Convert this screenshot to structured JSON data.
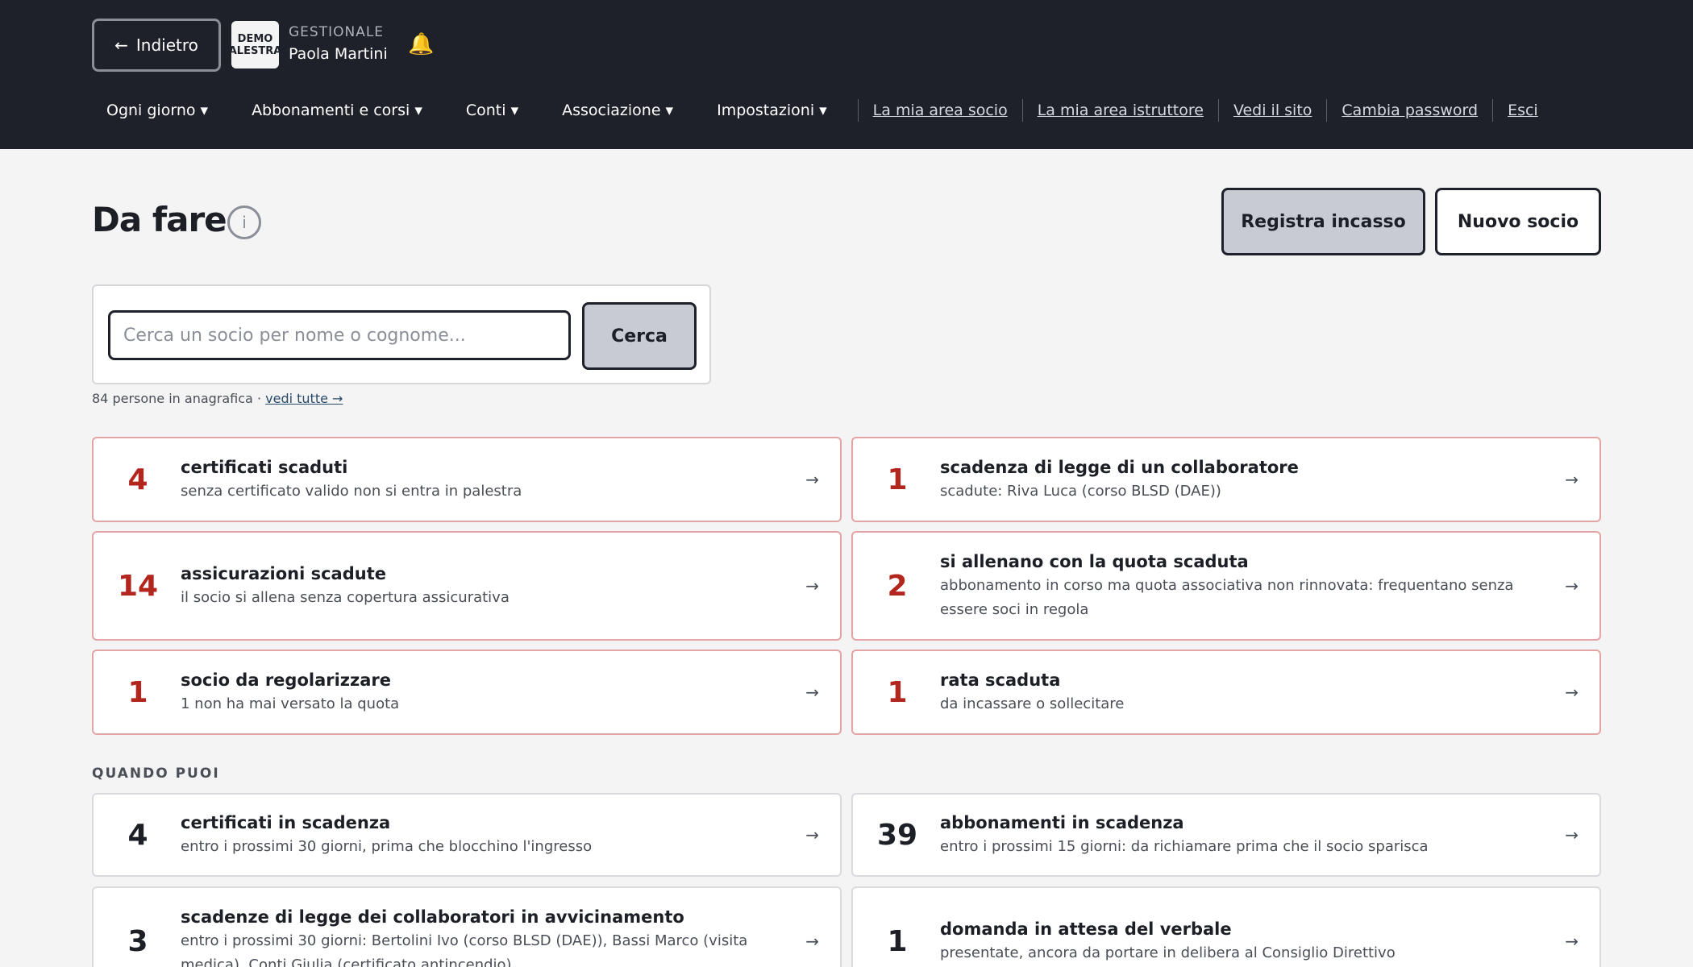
{
  "header": {
    "back_label": "Indietro",
    "back_icon": "arrow-left-icon",
    "logo_text": "DEMO ALESTRA",
    "brand_subtitle": "GESTIONALE",
    "user_name": "Paola Martini",
    "bell_icon": "bell-icon",
    "menus": [
      {
        "label": "Ogni giorno ▾"
      },
      {
        "label": "Abbonamenti e corsi ▾"
      },
      {
        "label": "Conti ▾"
      },
      {
        "label": "Associazione ▾"
      },
      {
        "label": "Impostazioni ▾"
      }
    ],
    "links": [
      {
        "label": "La mia area socio"
      },
      {
        "label": "La mia area istruttore"
      },
      {
        "label": "Vedi il sito"
      },
      {
        "label": "Cambia password"
      },
      {
        "label": "Esci"
      }
    ]
  },
  "page": {
    "title": "Da fare",
    "info_icon": "i",
    "primary_action": "Registra incasso",
    "secondary_action": "Nuovo socio"
  },
  "search": {
    "placeholder": "Cerca un socio per nome o cognome...",
    "value": "",
    "button_label": "Cerca",
    "registry_text": "84 persone in anagrafica ·",
    "registry_link": "vedi tutte →"
  },
  "urgent_cards": [
    {
      "count": "4",
      "title": "certificati scaduti",
      "desc": "senza certificato valido non si entra in palestra",
      "arrow": "→"
    },
    {
      "count": "1",
      "title": "scadenza di legge di un collaboratore",
      "desc": "scadute: Riva Luca (corso BLSD (DAE))",
      "arrow": "→"
    },
    {
      "count": "14",
      "title": "assicurazioni scadute",
      "desc": "il socio si allena senza copertura assicurativa",
      "arrow": "→"
    },
    {
      "count": "2",
      "title": "si allenano con la quota scaduta",
      "desc": "abbonamento in corso ma quota associativa non rinnovata: frequentano senza essere soci in regola",
      "arrow": "→"
    },
    {
      "count": "1",
      "title": "socio da regolarizzare",
      "desc": "1 non ha mai versato la quota",
      "arrow": "→"
    },
    {
      "count": "1",
      "title": "rata scaduta",
      "desc": "da incassare o sollecitare",
      "arrow": "→"
    }
  ],
  "when_you_can": {
    "label": "QUANDO PUOI",
    "cards": [
      {
        "count": "4",
        "title": "certificati in scadenza",
        "desc": "entro i prossimi 30 giorni, prima che blocchino l'ingresso",
        "arrow": "→"
      },
      {
        "count": "39",
        "title": "abbonamenti in scadenza",
        "desc": "entro i prossimi 15 giorni: da richiamare prima che il socio sparisca",
        "arrow": "→"
      },
      {
        "count": "3",
        "title": "scadenze di legge dei collaboratori in avvicinamento",
        "desc": "entro i prossimi 30 giorni: Bertolini Ivo (corso BLSD (DAE)), Bassi Marco (visita medica), Conti Giulia (certificato antincendio)",
        "arrow": "→"
      },
      {
        "count": "1",
        "title": "domanda in attesa del verbale",
        "desc": "presentate, ancora da portare in delibera al Consiglio Direttivo",
        "arrow": "→"
      }
    ]
  },
  "colors": {
    "topbar": "#1e2129",
    "urgent": "#b3261e",
    "urgent_border": "#e4a4a4",
    "bell": "#f2c200"
  }
}
